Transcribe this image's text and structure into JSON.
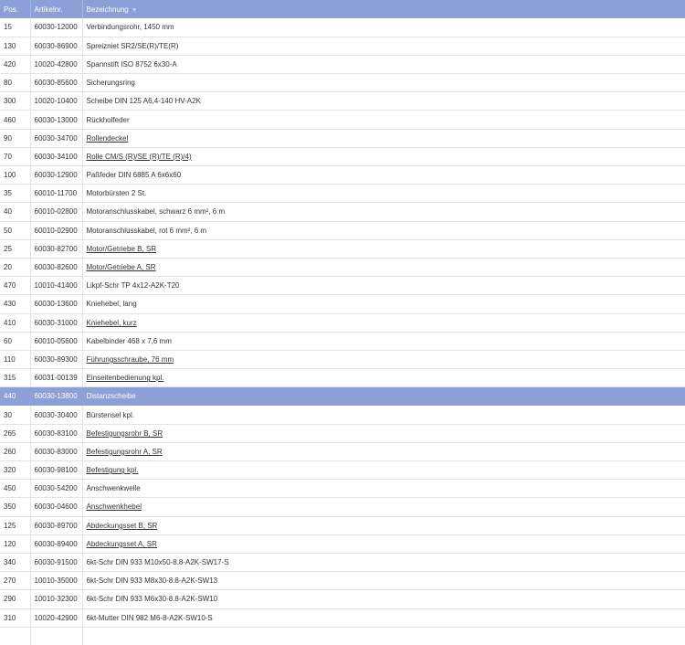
{
  "header": {
    "pos": "Pos.",
    "artikelnr": "Artikelnr.",
    "bezeichnung": "Bezeichnung",
    "sort_icon": "sort-desc-icon"
  },
  "colors": {
    "header_bg": "#8c9fd6",
    "selected_row_bg": "#8c9fd6",
    "grid_line": "#e3e3e3"
  },
  "rows": [
    {
      "pos": "15",
      "art": "60030-12000",
      "desc": "Verbindungsrohr, 1450 mm",
      "link": false,
      "selected": false
    },
    {
      "pos": "130",
      "art": "60030-86900",
      "desc": "Spreizniet SR2/SE(R)/TE(R)",
      "link": false,
      "selected": false
    },
    {
      "pos": "420",
      "art": "10020-42800",
      "desc": "Spannstift ISO 8752 6x30-A",
      "link": false,
      "selected": false
    },
    {
      "pos": "80",
      "art": "60030-85600",
      "desc": "Sicherungsring",
      "link": false,
      "selected": false
    },
    {
      "pos": "300",
      "art": "10020-10400",
      "desc": "Scheibe DIN 125 A6,4-140 HV-A2K",
      "link": false,
      "selected": false
    },
    {
      "pos": "460",
      "art": "60030-13000",
      "desc": "Rückholfeder",
      "link": false,
      "selected": false
    },
    {
      "pos": "90",
      "art": "60030-34700",
      "desc": "Rollendeckel",
      "link": true,
      "selected": false
    },
    {
      "pos": "70",
      "art": "60030-34100",
      "desc": "Rolle CM/S (R)/SE (R)/TE (R)/4)",
      "link": true,
      "selected": false
    },
    {
      "pos": "100",
      "art": "60030-12900",
      "desc": "Paßfeder DIN 6885 A 6x6x60",
      "link": false,
      "selected": false
    },
    {
      "pos": "35",
      "art": "60010-11700",
      "desc": "Motorbürsten 2 St.",
      "link": false,
      "selected": false
    },
    {
      "pos": "40",
      "art": "60010-02800",
      "desc": "Motoranschlusskabel, schwarz 6 mm², 6 m",
      "link": false,
      "selected": false
    },
    {
      "pos": "50",
      "art": "60010-02900",
      "desc": "Motoranschlusskabel, rot 6 mm², 6 m",
      "link": false,
      "selected": false
    },
    {
      "pos": "25",
      "art": "60030-82700",
      "desc": "Motor/Getriebe B, SR",
      "link": true,
      "selected": false
    },
    {
      "pos": "20",
      "art": "60030-82600",
      "desc": "Motor/Getriebe A, SR",
      "link": true,
      "selected": false
    },
    {
      "pos": "470",
      "art": "10010-41400",
      "desc": "Likpf-Schr TP 4x12-A2K-T20",
      "link": false,
      "selected": false
    },
    {
      "pos": "430",
      "art": "60030-13600",
      "desc": "Kniehebel, lang",
      "link": false,
      "selected": false
    },
    {
      "pos": "410",
      "art": "60030-31000",
      "desc": "Kniehebel, kurz",
      "link": true,
      "selected": false
    },
    {
      "pos": "60",
      "art": "60010-05600",
      "desc": "Kabelbinder 468 x 7,6 mm",
      "link": false,
      "selected": false
    },
    {
      "pos": "110",
      "art": "60030-89300",
      "desc": "Führungsschraube, 76 mm",
      "link": true,
      "selected": false
    },
    {
      "pos": "315",
      "art": "60031-00139",
      "desc": "Einseitenbedienung kpl.",
      "link": true,
      "selected": false
    },
    {
      "pos": "440",
      "art": "60030-13800",
      "desc": "Distanzscheibe",
      "link": false,
      "selected": true
    },
    {
      "pos": "30",
      "art": "60030-30400",
      "desc": "Bürstensel kpl.",
      "link": false,
      "selected": false
    },
    {
      "pos": "265",
      "art": "60030-83100",
      "desc": "Befestigungsrohr B, SR",
      "link": true,
      "selected": false
    },
    {
      "pos": "260",
      "art": "60030-83000",
      "desc": "Befestigungsrohr A, SR",
      "link": true,
      "selected": false
    },
    {
      "pos": "320",
      "art": "60030-98100",
      "desc": "Befestigung kpl.",
      "link": true,
      "selected": false
    },
    {
      "pos": "450",
      "art": "60030-54200",
      "desc": "Anschwenkwelle",
      "link": false,
      "selected": false
    },
    {
      "pos": "350",
      "art": "60030-04600",
      "desc": "Anschwenkhebel",
      "link": true,
      "selected": false
    },
    {
      "pos": "125",
      "art": "60030-89700",
      "desc": "Abdeckungsset B, SR",
      "link": true,
      "selected": false
    },
    {
      "pos": "120",
      "art": "60030-89400",
      "desc": "Abdeckungsset A, SR",
      "link": true,
      "selected": false
    },
    {
      "pos": "340",
      "art": "60030-91500",
      "desc": "6kt-Schr DIN 933 M10x50-8.8-A2K-SW17-S",
      "link": false,
      "selected": false
    },
    {
      "pos": "270",
      "art": "10010-35000",
      "desc": "6kt-Schr DIN 933 M8x30-8.8-A2K-SW13",
      "link": false,
      "selected": false
    },
    {
      "pos": "290",
      "art": "10010-32300",
      "desc": "6kt-Schr DIN 933 M6x30-8.8-A2K-SW10",
      "link": false,
      "selected": false
    },
    {
      "pos": "310",
      "art": "10020-42900",
      "desc": "6kt-Mutter DIN 982 M6-8-A2K-SW10-S",
      "link": false,
      "selected": false
    }
  ]
}
